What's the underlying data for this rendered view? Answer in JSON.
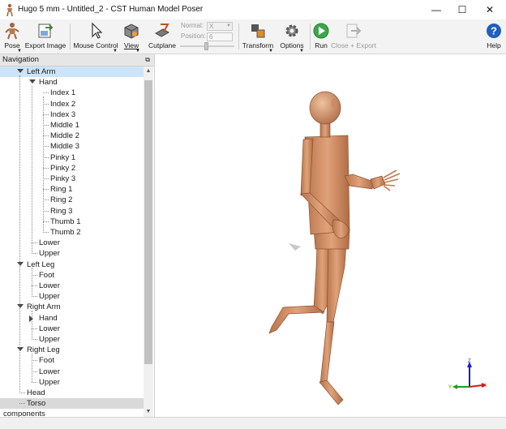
{
  "window": {
    "title": "Hugo 5 mm - Untitled_2 - CST Human Model Poser",
    "minimize": "—",
    "maximize": "☐",
    "close": "✕"
  },
  "toolbar": {
    "pose": "Pose",
    "export_image": "Export Image",
    "mouse_control": "Mouse Control",
    "view": "View",
    "cutplane": "Cutplane",
    "normal_label": "Normal:",
    "normal_value": "X",
    "position_label": "Position:",
    "position_value": "6",
    "transform": "Transform",
    "options": "Options",
    "run": "Run",
    "close_export": "Close + Export",
    "help": "Help"
  },
  "navigation": {
    "title": "Navigation",
    "items": [
      {
        "label": "Left Arm"
      },
      {
        "label": "Hand"
      },
      {
        "label": "Index 1"
      },
      {
        "label": "Index 2"
      },
      {
        "label": "Index 3"
      },
      {
        "label": "Middle 1"
      },
      {
        "label": "Middle 2"
      },
      {
        "label": "Middle 3"
      },
      {
        "label": "Pinky 1"
      },
      {
        "label": "Pinky 2"
      },
      {
        "label": "Pinky 3"
      },
      {
        "label": "Ring 1"
      },
      {
        "label": "Ring 2"
      },
      {
        "label": "Ring 3"
      },
      {
        "label": "Thumb 1"
      },
      {
        "label": "Thumb 2"
      },
      {
        "label": "Lower"
      },
      {
        "label": "Upper"
      },
      {
        "label": "Left Leg"
      },
      {
        "label": "Foot"
      },
      {
        "label": "Lower"
      },
      {
        "label": "Upper"
      },
      {
        "label": "Right Arm"
      },
      {
        "label": "Hand"
      },
      {
        "label": "Lower"
      },
      {
        "label": "Upper"
      },
      {
        "label": "Right Leg"
      },
      {
        "label": "Foot"
      },
      {
        "label": "Lower"
      },
      {
        "label": "Upper"
      },
      {
        "label": "Head"
      },
      {
        "label": "Torso"
      },
      {
        "label": "components"
      }
    ]
  },
  "viewport": {
    "axes": {
      "x": "X",
      "y": "Y",
      "z": "Z"
    },
    "colors": {
      "skin": "#d9956a",
      "x_axis": "#d21a1a",
      "y_axis": "#1aa01a",
      "z_axis": "#1a1ad2"
    }
  }
}
